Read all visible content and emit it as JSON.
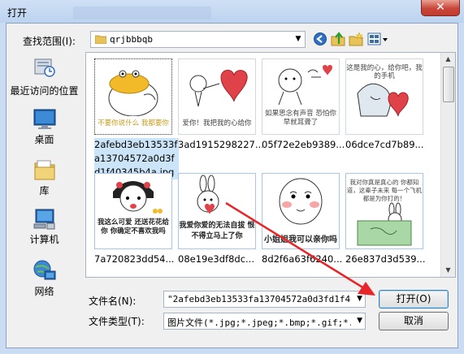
{
  "window": {
    "title": "打开",
    "close_glyph": "✕"
  },
  "lookin": {
    "label": "查找范围(I):",
    "value": "qrjbbbqb",
    "arrow": "▼"
  },
  "toolbar_icons": [
    "back-icon",
    "up-folder-icon",
    "new-folder-icon",
    "views-menu-icon"
  ],
  "places": [
    {
      "label": "最近访问的位置",
      "icon": "recent-places-icon"
    },
    {
      "label": "桌面",
      "icon": "desktop-icon"
    },
    {
      "label": "库",
      "icon": "libraries-icon"
    },
    {
      "label": "计算机",
      "icon": "computer-icon"
    },
    {
      "label": "网络",
      "icon": "network-icon"
    }
  ],
  "files": [
    {
      "name": "2afebd3eb13533fa13704572a0d3fd1f40345b4a.jpg",
      "caption": "不要你说什么 我都要你",
      "selected": true
    },
    {
      "name": "3ad1915298227...",
      "caption": "爱你！我把我的心给你",
      "selected": false
    },
    {
      "name": "05f72e2eb9389...",
      "caption": "如果思念有声音 恐怕你早就耳聋了",
      "selected": false
    },
    {
      "name": "06dce7cd7b89...",
      "caption": "这是我的心，给你吧，我的手机",
      "selected": false
    },
    {
      "name": "7a720823dd54...",
      "caption": "我这么可爱 还送花花给你 你确定不喜欢我吗",
      "selected": false
    },
    {
      "name": "08e19e3df8dc...",
      "caption": "我爱你爱的无法自拔 恨不得立马上了你",
      "selected": false
    },
    {
      "name": "8d2f6a63f6240...",
      "caption": "小姐姐我可以亲你吗",
      "selected": false
    },
    {
      "name": "26e837d3d539...",
      "caption": "我对你真是真心的 你都知道，这辈子未来 每一个飞机都是为你打的！",
      "selected": false
    }
  ],
  "filename": {
    "label": "文件名(N):",
    "value": "\"2afebd3eb13533fa13704572a0d3fd1f4034",
    "arrow": "▼"
  },
  "filetype": {
    "label": "文件类型(T):",
    "value": "图片文件(*.jpg;*.jpeg;*.bmp;*.gif;*.p",
    "arrow": "▼"
  },
  "buttons": {
    "open": "打开(O)",
    "cancel": "取消"
  },
  "colors": {
    "selection": "#cce4f7",
    "annotation_arrow": "#e8262a",
    "accent_heart": "#e0424a"
  }
}
